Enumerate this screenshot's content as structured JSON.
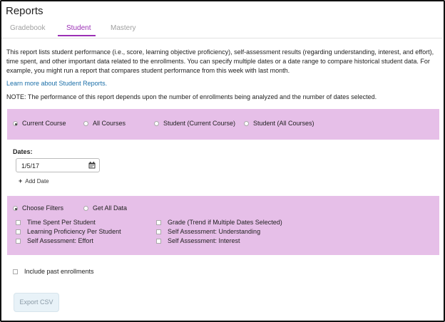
{
  "header": {
    "title": "Reports"
  },
  "tabs": [
    {
      "label": "Gradebook",
      "active": false
    },
    {
      "label": "Student",
      "active": true
    },
    {
      "label": "Mastery",
      "active": false
    }
  ],
  "description": "This report lists student performance (i.e., score, learning objective proficiency), self-assessment results (regarding understanding, interest, and effort), time spent, and other important data related to the enrollments. You can specify multiple dates or a date range to compare historical student data. For example, you might run a report that compares student performance from this week with last month.",
  "learn_more_link": "Learn more about Student Reports.",
  "note": "NOTE: The performance of this report depends upon the number of enrollments being analyzed and the number of dates selected.",
  "scope_options": [
    {
      "label": "Current Course",
      "selected": true
    },
    {
      "label": "All Courses",
      "selected": false
    },
    {
      "label": "Student (Current Course)",
      "selected": false
    },
    {
      "label": "Student (All Courses)",
      "selected": false
    }
  ],
  "dates": {
    "label": "Dates:",
    "value": "1/5/17",
    "add_label": "Add Date"
  },
  "filter_mode_options": [
    {
      "label": "Choose Filters",
      "selected": true
    },
    {
      "label": "Get All Data",
      "selected": false
    }
  ],
  "filters": {
    "time_spent": "Time Spent Per Student",
    "learning_proficiency": "Learning Proficiency Per Student",
    "self_assessment_effort": "Self Assessment: Effort",
    "grade": "Grade (Trend if Multiple Dates Selected)",
    "self_assessment_understanding": "Self Assessment: Understanding",
    "self_assessment_interest": "Self Assessment: Interest"
  },
  "include_past_enrollments": "Include past enrollments",
  "export_button": "Export CSV",
  "colors": {
    "accent": "#9b30b5",
    "option_band": "#e6bfe8",
    "link": "#1a6ea8",
    "export_bg": "#e8f2f8"
  }
}
